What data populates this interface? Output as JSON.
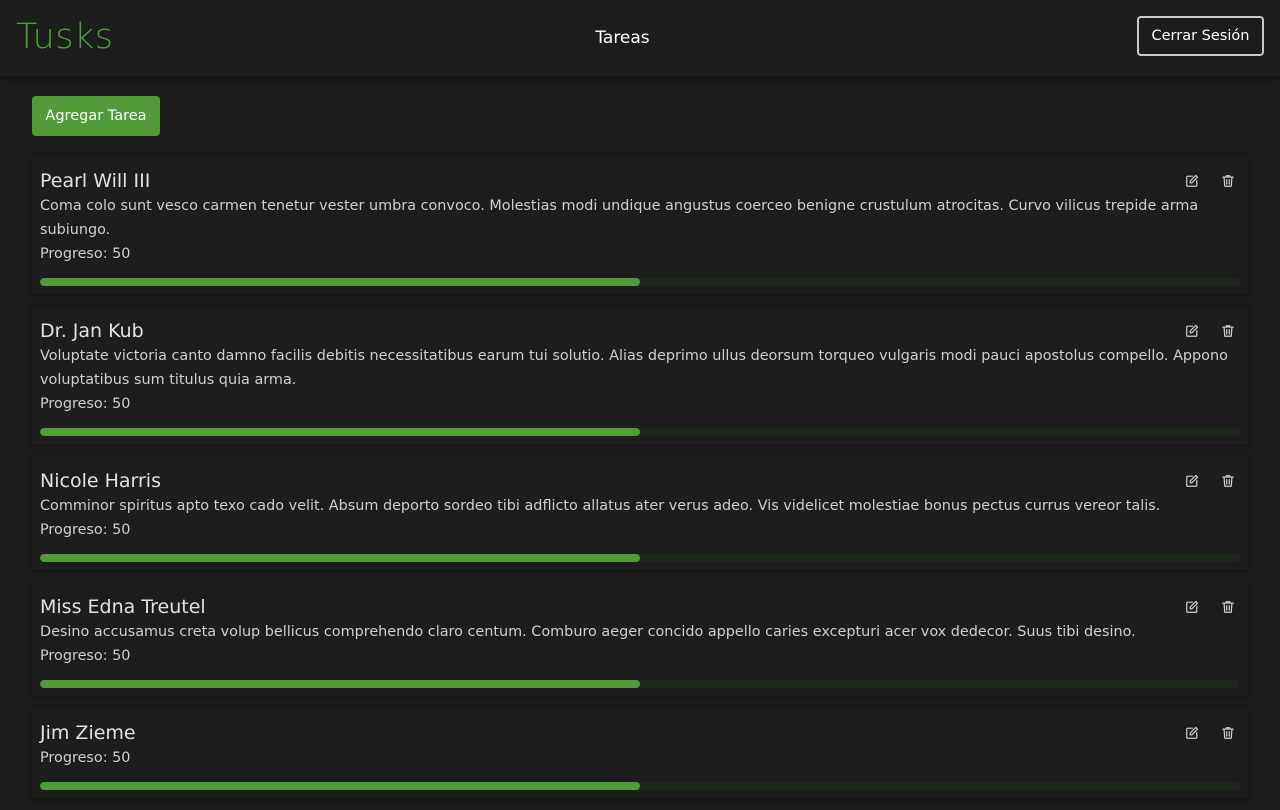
{
  "header": {
    "logo": "Tusks",
    "nav_label": "Tareas",
    "logout_label": "Cerrar Sesión"
  },
  "actions": {
    "add_label": "Agregar Tarea"
  },
  "colors": {
    "accent": "#4f9c39",
    "track": "#1e271b"
  },
  "icons": {
    "edit": "edit-icon",
    "delete": "trash-icon"
  },
  "tasks": [
    {
      "title": "Pearl Will III",
      "description": "Coma colo sunt vesco carmen tenetur vester umbra convoco. Molestias modi undique angustus coerceo benigne crustulum atrocitas. Curvo vilicus trepide arma subiungo.",
      "progress_label": "Progreso:",
      "progress": 50
    },
    {
      "title": "Dr. Jan Kub",
      "description": "Voluptate victoria canto damno facilis debitis necessitatibus earum tui solutio. Alias deprimo ullus deorsum torqueo vulgaris modi pauci apostolus compello. Appono voluptatibus sum titulus quia arma.",
      "progress_label": "Progreso:",
      "progress": 50
    },
    {
      "title": "Nicole Harris",
      "description": "Comminor spiritus apto texo cado velit. Absum deporto sordeo tibi adflicto allatus ater verus adeo. Vis videlicet molestiae bonus pectus currus vereor talis.",
      "progress_label": "Progreso:",
      "progress": 50
    },
    {
      "title": "Miss Edna Treutel",
      "description": "Desino accusamus creta volup bellicus comprehendo claro centum. Comburo aeger concido appello caries excepturi acer vox dedecor. Suus tibi desino.",
      "progress_label": "Progreso:",
      "progress": 50
    },
    {
      "title": "Jim Zieme",
      "description": "",
      "progress_label": "Progreso:",
      "progress": 50
    }
  ]
}
